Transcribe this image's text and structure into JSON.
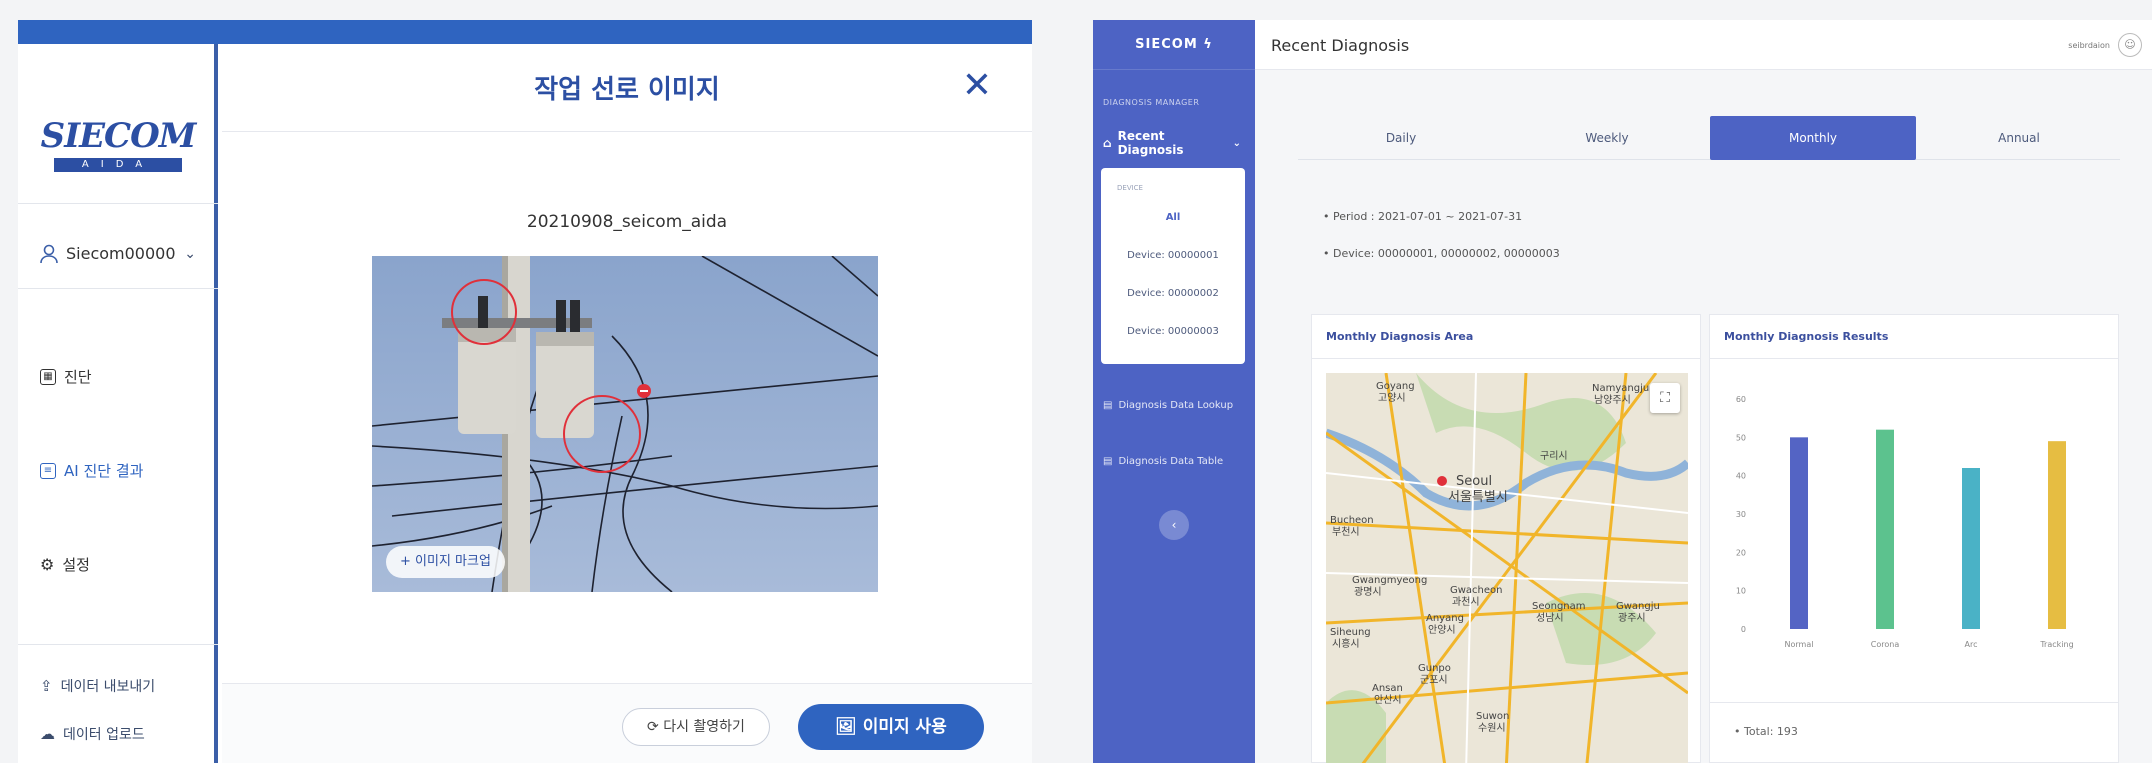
{
  "left": {
    "logo": {
      "main": "SIECOM",
      "sub": "AIDA"
    },
    "user": {
      "name": "Siecom00000"
    },
    "nav": [
      {
        "label": "진단",
        "icon": "calendar-icon"
      },
      {
        "label": "AI 진단 결과",
        "icon": "document-icon"
      },
      {
        "label": "설정",
        "icon": "gear-icon"
      }
    ],
    "bottom_links": [
      {
        "label": "데이터 내보내기",
        "icon": "upload-icon"
      },
      {
        "label": "데이터 업로드",
        "icon": "cloud-upload-icon"
      }
    ],
    "modal": {
      "title": "작업 선로 이미지",
      "close": "✕",
      "image_name": "20210908_seicom_aida",
      "markup_button": "+ 이미지 마크업",
      "retake_button": "⟳ 다시 촬영하기",
      "use_button": "이미지 사용"
    }
  },
  "right": {
    "logo": "SIECOM ϟ",
    "section_label": "DIAGNOSIS MANAGER",
    "active_menu": "Recent Diagnosis",
    "device_panel": {
      "label": "DEVICE",
      "items": [
        "All",
        "Device: 00000001",
        "Device: 00000002",
        "Device: 00000003"
      ]
    },
    "menu": [
      "Diagnosis Data Lookup",
      "Diagnosis Data Table"
    ],
    "collapse": "‹",
    "page_title": "Recent Diagnosis",
    "user_name": "seibrdaion",
    "tabs": [
      "Daily",
      "Weekly",
      "Monthly",
      "Annual"
    ],
    "active_tab": "Monthly",
    "info": {
      "period": "Period : 2021-07-01 ~ 2021-07-31",
      "device": "Device: 00000001, 00000002, 00000003"
    },
    "map_card": {
      "title": "Monthly Diagnosis Area",
      "labels": [
        "Goyang",
        "고양시",
        "Seoul",
        "서울특별시",
        "Bucheon",
        "부천시",
        "Gwangmyeong",
        "광명시",
        "Anyang",
        "안양시",
        "Gwacheon",
        "과천시",
        "Seongnam",
        "성남시",
        "Gunpo",
        "군포시",
        "Ansan",
        "안산시",
        "Suwon",
        "수원시",
        "Gwangju",
        "광주시",
        "Namyangju",
        "남양주시",
        "구리시",
        "Siheung",
        "시흥시"
      ]
    },
    "chart_card": {
      "title": "Monthly Diagnosis Results",
      "total": "Total: 193"
    }
  },
  "chart_data": {
    "type": "bar",
    "title": "Monthly Diagnosis Results",
    "categories": [
      "Normal",
      "Corona",
      "Arc",
      "Tracking"
    ],
    "values": [
      50,
      52,
      42,
      49
    ],
    "colors": [
      "#5464c4",
      "#5cc28e",
      "#4ab2c6",
      "#e6bd42"
    ],
    "yticks": [
      0,
      10,
      20,
      30,
      40,
      50,
      60
    ],
    "ylim": [
      0,
      60
    ]
  }
}
